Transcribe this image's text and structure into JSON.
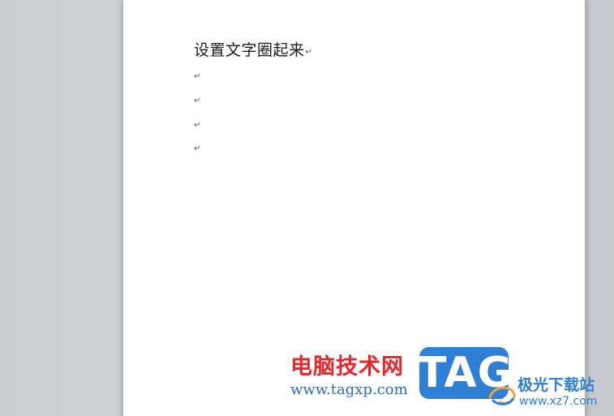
{
  "document": {
    "title_text": "设置文字圈起来",
    "paragraph_mark": "↵",
    "empty_paragraphs": [
      "↵",
      "↵",
      "↵",
      "↵"
    ]
  },
  "watermark": {
    "site_name_cn": "电脑技术网",
    "site_url": "www.tagxp.com",
    "logo_text": "TAG",
    "partner_name_cn": "极光下载站",
    "partner_url": "www.xz7.com"
  },
  "colors": {
    "background": "#d1d4d8",
    "page": "#ffffff",
    "watermark_red": "#e8262b",
    "watermark_blue": "#2f7fd6"
  }
}
